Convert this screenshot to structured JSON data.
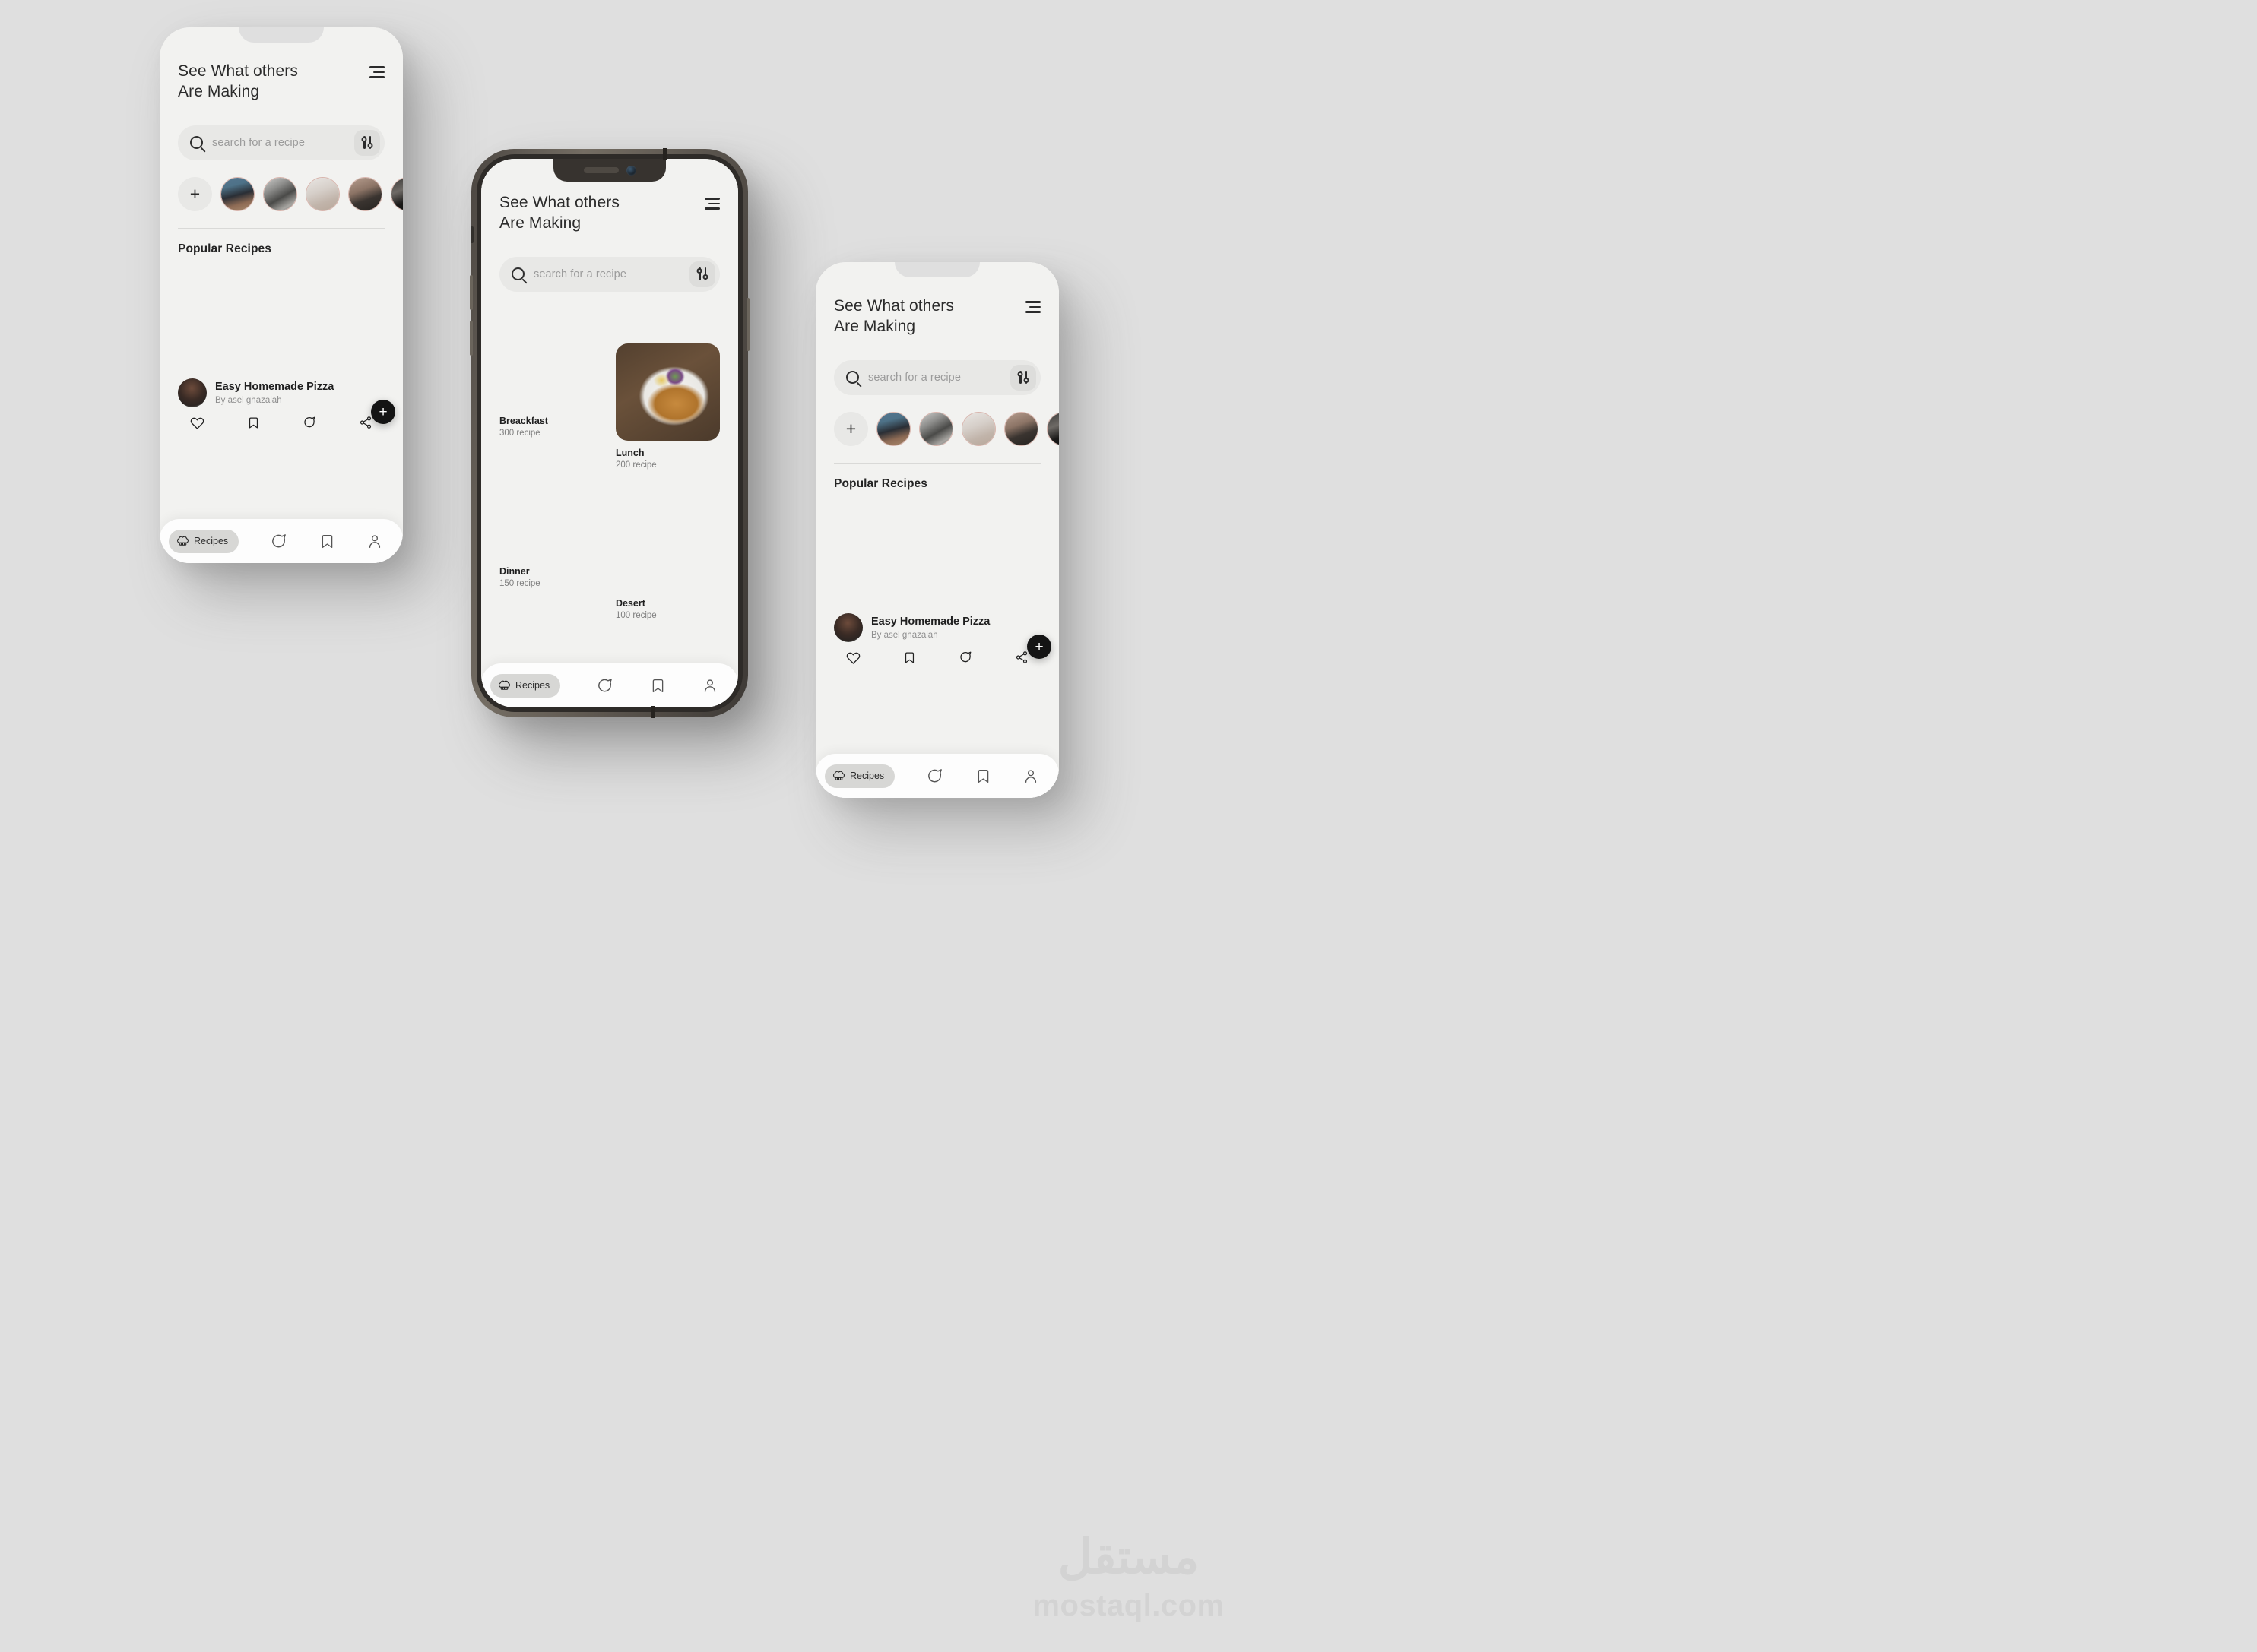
{
  "app": {
    "header": {
      "title": "See What others\nAre Making",
      "sort_icon": "sort-lines-icon"
    },
    "search": {
      "placeholder": "search for a recipe",
      "value": "",
      "search_icon": "search-icon",
      "filter_icon": "filter-sliders-icon"
    },
    "stories": {
      "add_label": "+",
      "items": [
        {
          "name": "story-avatar-1"
        },
        {
          "name": "story-avatar-2"
        },
        {
          "name": "story-avatar-3"
        },
        {
          "name": "story-avatar-4"
        },
        {
          "name": "story-avatar-5"
        }
      ]
    },
    "popular": {
      "section_title": "Popular Recipes",
      "recipe": {
        "title": "Easy Homemade Pizza",
        "byline": "By asel ghazalah",
        "actions": [
          {
            "name": "like-icon",
            "label": "heart"
          },
          {
            "name": "bookmark-icon",
            "label": "bookmark"
          },
          {
            "name": "comment-icon",
            "label": "comment"
          },
          {
            "name": "share-icon",
            "label": "share"
          }
        ]
      },
      "fab_label": "+"
    },
    "categories": [
      {
        "name": "Breackfast",
        "count": "300 recipe"
      },
      {
        "name": "Lunch",
        "count": "200 recipe"
      },
      {
        "name": "Dinner",
        "count": "150 recipe"
      },
      {
        "name": "Desert",
        "count": "100 recipe"
      }
    ],
    "bottom_nav": {
      "active_label": "Recipes",
      "active_icon": "chef-hat-icon",
      "items": [
        {
          "name": "nav-comments",
          "icon": "comment-icon"
        },
        {
          "name": "nav-saved",
          "icon": "bookmark-icon"
        },
        {
          "name": "nav-profile",
          "icon": "person-icon"
        }
      ]
    }
  },
  "watermark": {
    "arabic": "مستقل",
    "latin": "mostaql.com"
  },
  "colors": {
    "background": "#dfdfdf",
    "screen": "#f2f2f0",
    "search_field": "#e8e8e6",
    "accent_dark": "#141414",
    "text_primary": "#1f1f1f",
    "text_muted": "#8e8e8e",
    "story_ring": "#d8b6ae",
    "bezel": "#4b4641"
  }
}
